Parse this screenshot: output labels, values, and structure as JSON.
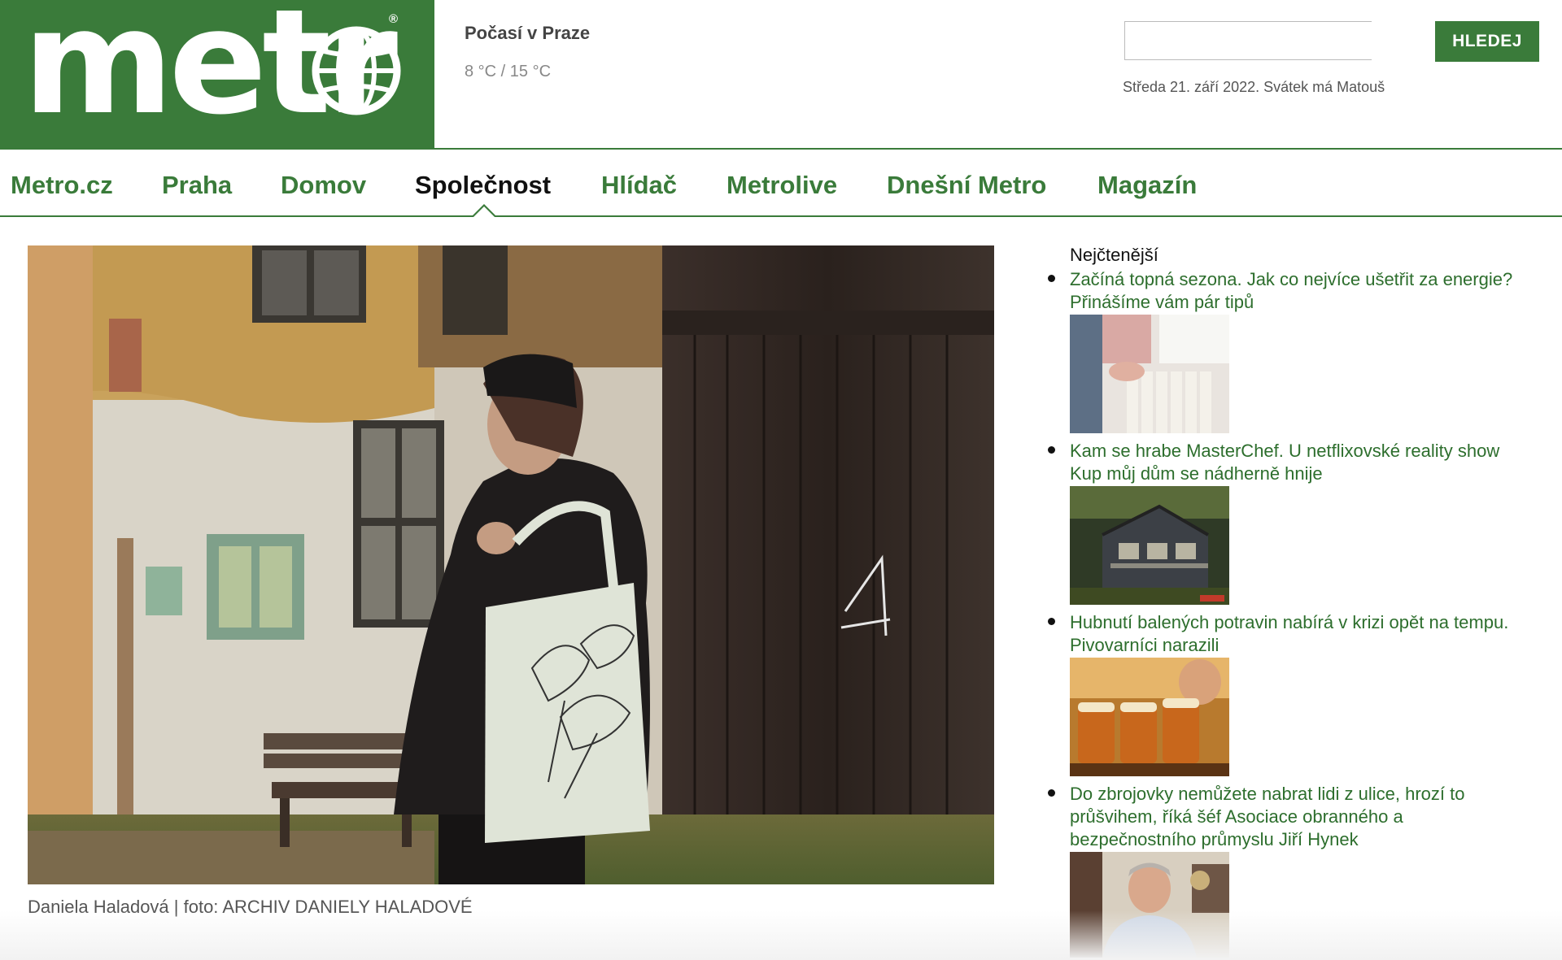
{
  "brand": {
    "logo_text": "metr",
    "registered_mark": "®",
    "color": "#3a7b3a"
  },
  "weather": {
    "title": "Počasí v Praze",
    "temperature": "8 °C / 15 °C"
  },
  "search": {
    "placeholder": "",
    "button_label": "HLEDEJ"
  },
  "date_line": "Středa 21. září 2022. Svátek má Matouš",
  "nav": {
    "items": [
      {
        "label": "Metro.cz"
      },
      {
        "label": "Praha"
      },
      {
        "label": "Domov"
      },
      {
        "label": "Společnost",
        "active": true
      },
      {
        "label": "Hlídač"
      },
      {
        "label": "Metrolive"
      },
      {
        "label": "Dnešní Metro"
      },
      {
        "label": "Magazín"
      }
    ]
  },
  "article": {
    "photo_caption": "Daniela Haladová | foto: ARCHIV DANIELY HALADOVÉ"
  },
  "most_read": {
    "title": "Nejčtenější",
    "items": [
      {
        "line1": "Začíná topná sezona. Jak co nejvíce ušetřit za energie?",
        "line2": "Přinášíme vám pár tipů"
      },
      {
        "line1": "Kam se hrabe MasterChef. U netflixovské reality show",
        "line2": "Kup můj dům se nádherně hnije"
      },
      {
        "line1": "Hubnutí balených potravin nabírá v krizi opět na tempu.",
        "line2": "Pivovarníci narazili"
      },
      {
        "line1": "Do zbrojovky nemůžete nabrat lidi z ulice, hrozí to",
        "line2": "průšvihem, říká šéf Asociace obranného a",
        "line3": "bezpečnostního průmyslu Jiří Hynek"
      }
    ]
  }
}
